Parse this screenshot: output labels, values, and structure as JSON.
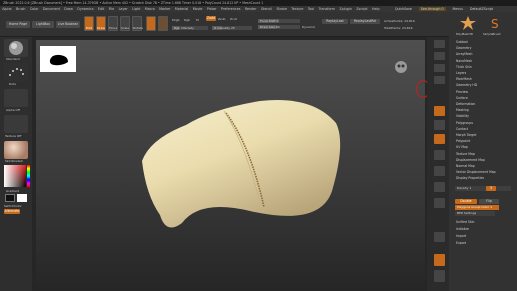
{
  "titlebar": {
    "text": "ZBrush 2022.0.6    [ZBrush Document]    • Free Mem 14.379GB • Active Mem 402 • Scratch Disk 78 • ZTime 1.668 Timer 0.018 • PolyCount 24.812 KP • MeshCount 1"
  },
  "menubar": {
    "items": [
      "Alpha",
      "Brush",
      "Color",
      "Document",
      "Draw",
      "Dynamics",
      "Edit",
      "File",
      "Layer",
      "Light",
      "Macro",
      "Marker",
      "Material",
      "Movie",
      "Picker",
      "Preferences",
      "Render",
      "Stencil",
      "Stroke",
      "Texture",
      "Tool",
      "Transform",
      "Zplugin",
      "Zscript",
      "Help"
    ],
    "quicksave": "QuickSave",
    "seethrough": "See-through 0",
    "menus": "Menus",
    "default_script": "DefaultZScript"
  },
  "topbar": {
    "home_page": "Home Page",
    "lightbox": "LightBox",
    "live_boolean": "Live Boolean",
    "edit": "Edit",
    "draw": "Draw",
    "move": "Move",
    "scale": "Scale",
    "rotate": "Rotate",
    "mrgb": "Mrgb",
    "rgb": "Rgb",
    "m": "M",
    "zadd": "Zadd",
    "zsub": "Zsub",
    "zcut": "Zcut",
    "focal_shift": "Focal Shift 0",
    "draw_size": "Draw Size 64",
    "dynamic": "Dynamic",
    "rgb_intensity": "Rgb Intensity",
    "z_intensity": "Z Intensity 25",
    "replay_last": "ReplayLast",
    "replay_last_rel": "ReplayLastRel",
    "active_points": "ActivePoints: 24,816",
    "total_points": "TotalPoints: 24,816",
    "z_intensity_level": 0.25,
    "focal_shift_level": 0.5,
    "draw_size_level": 0.45
  },
  "left_tray": {
    "brush_label": "Standard",
    "stroke_label": "Dots",
    "alpha_label": "Alpha Off",
    "texture_label": "Texture Off",
    "material_label": "SkinShade4",
    "gradient_label": "Gradient",
    "switch_color": "SwitchColor",
    "alternate": "Alternate"
  },
  "right_panel": {
    "top_tools": [
      "PolyMesh3D",
      "Cylinder3D",
      "SimpleBrush",
      "SkinShade4"
    ],
    "subtool": "Subtool",
    "items": [
      "Subtool",
      "Geometry",
      "ArrayMesh",
      "NanoMesh",
      "Thick Skin",
      "Layers",
      "FiberMesh",
      "Geometry HD",
      "Preview",
      "Surface",
      "Deformation",
      "Masking",
      "Visibility",
      "Polygroups",
      "Contact",
      "Morph Target",
      "Polypaint",
      "UV Map",
      "Texture Map",
      "Displacement Map",
      "Normal Map",
      "Vector Displacement Map",
      "Display Properties"
    ],
    "density": "Density 1",
    "bpr_level": "3",
    "double": "Double",
    "flip": "Flip",
    "polygroups_display": "Polygons Group Color 1",
    "bpr_settings": "BPR Settings",
    "bottom_items": [
      "Unified Skin",
      "Initialize",
      "Import",
      "Export"
    ]
  },
  "colors": {
    "accent": "#c56a1a",
    "pillow": "#e8dcb0",
    "background": "#2b2b2b"
  }
}
